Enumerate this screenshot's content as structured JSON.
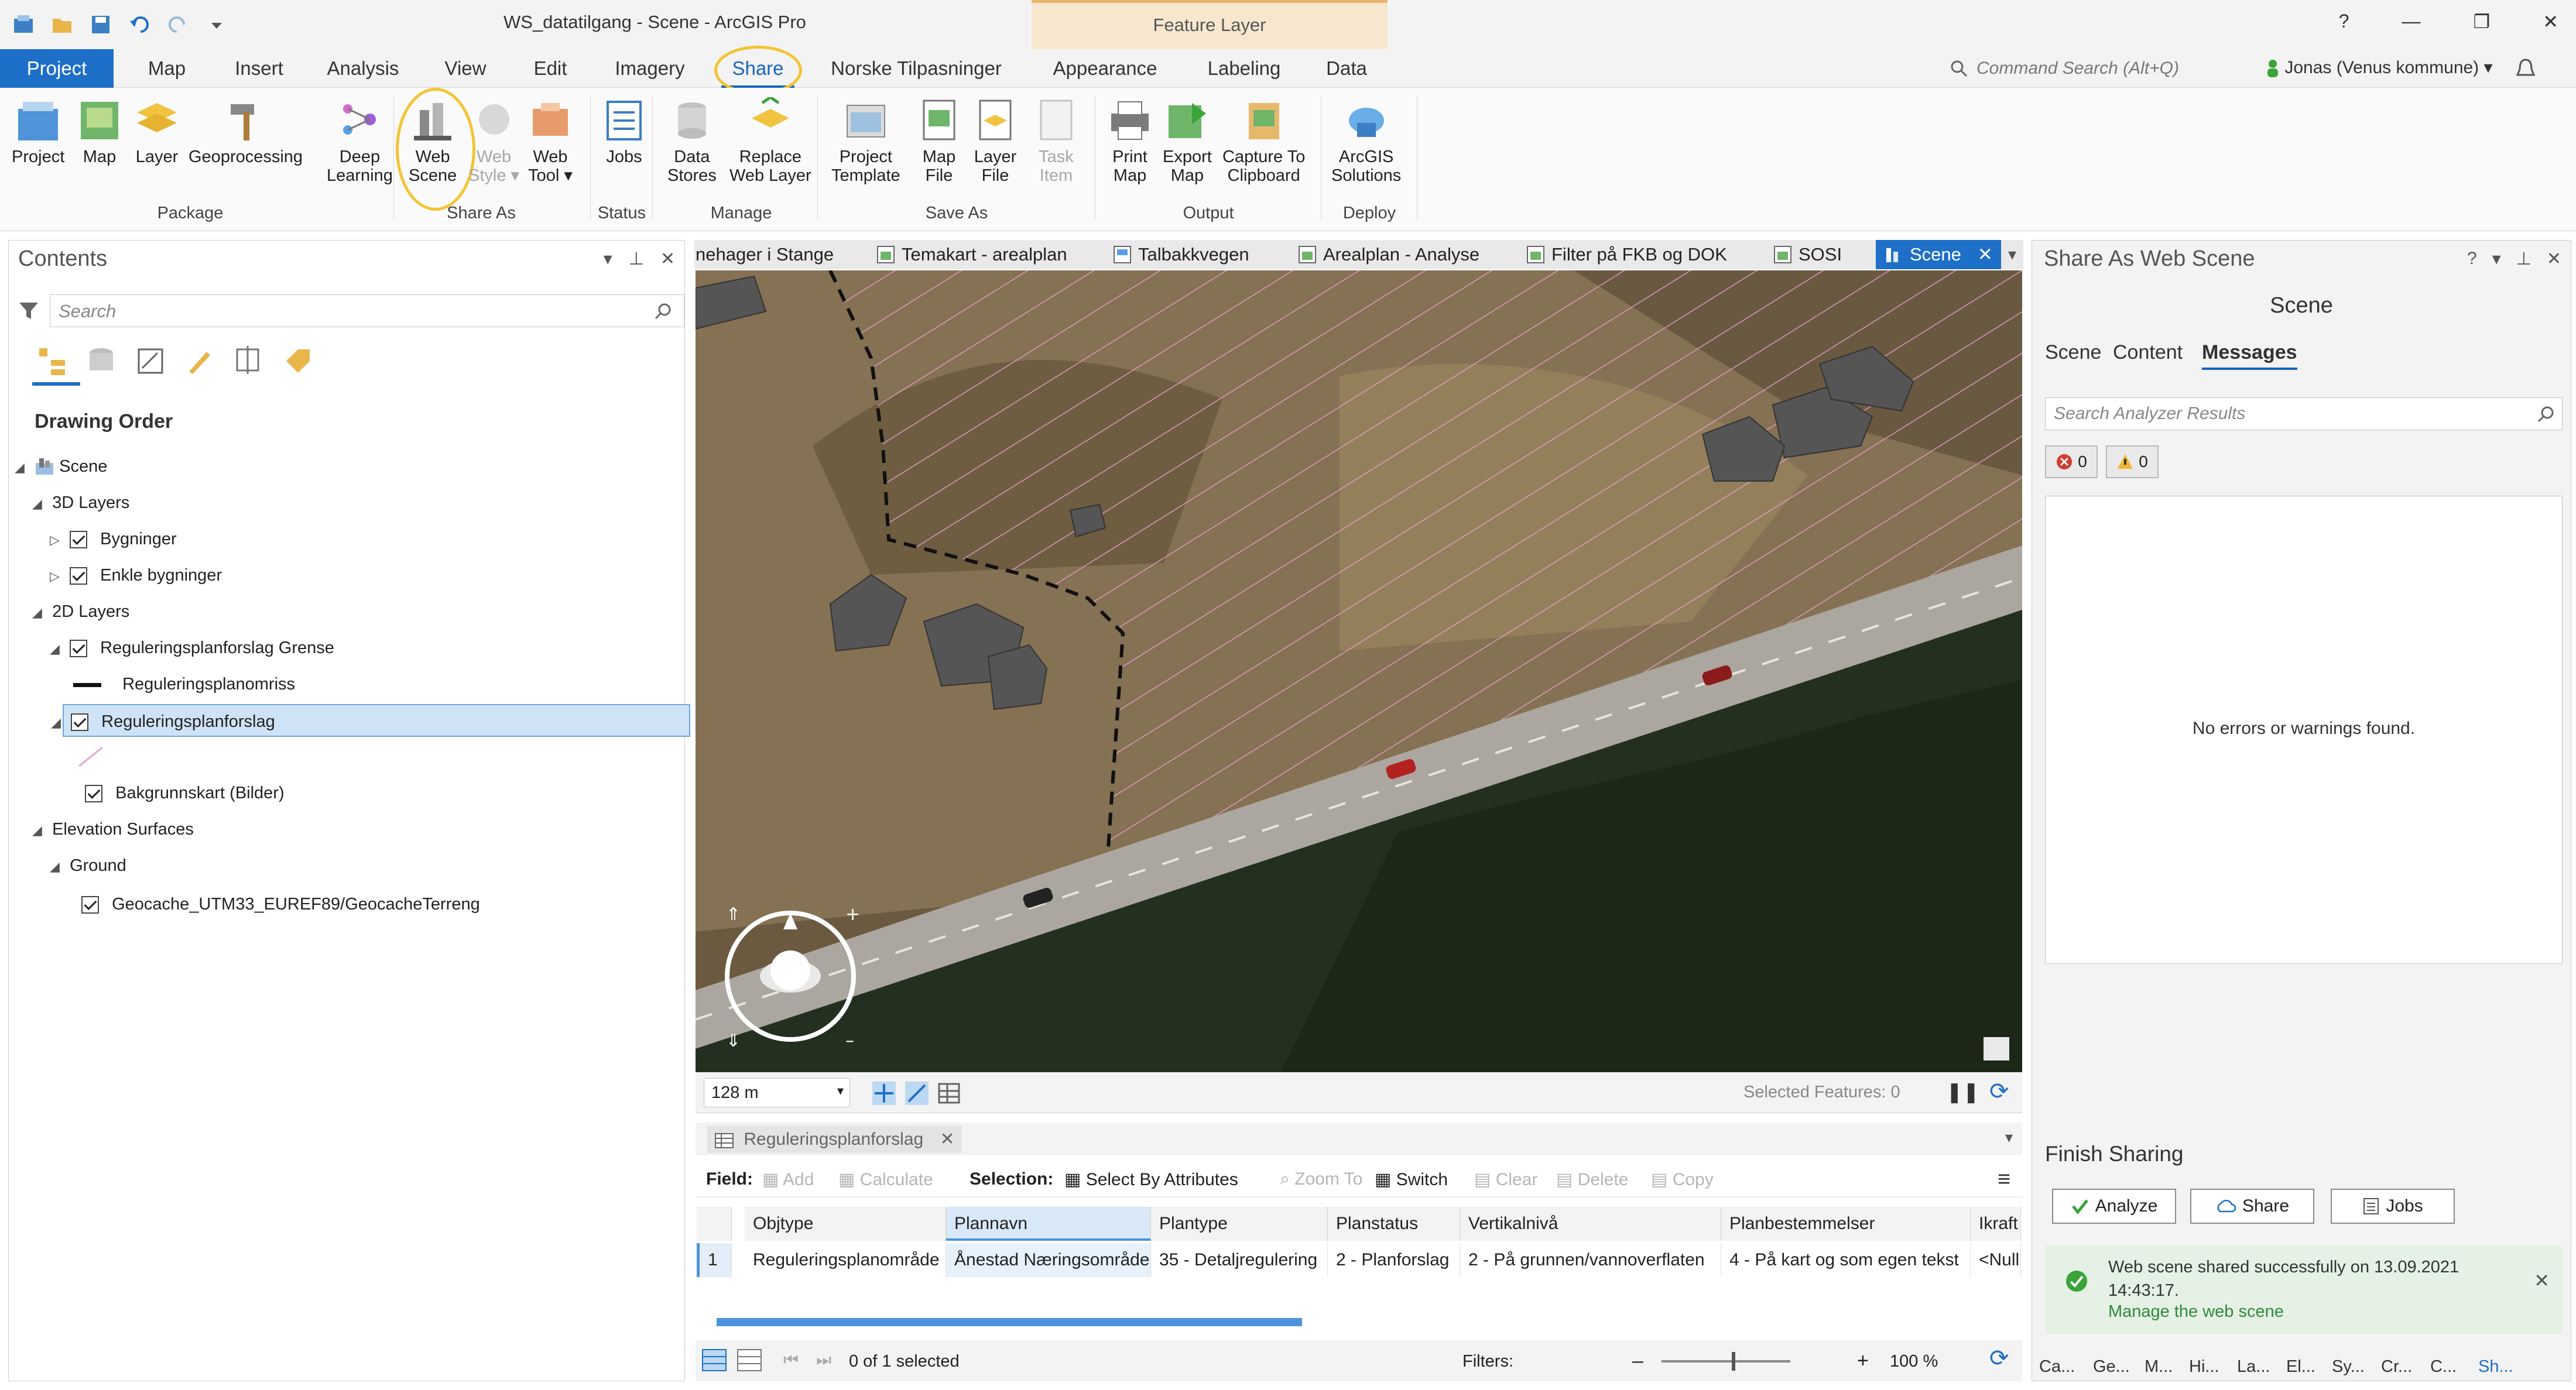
{
  "window": {
    "title": "WS_datatilgang - Scene - ArcGIS Pro",
    "context_tab_group": "Feature Layer",
    "help": "?",
    "minimize": "—",
    "maximize": "❐",
    "close": "✕"
  },
  "ribbon_tabs": [
    {
      "label": "Project"
    },
    {
      "label": "Map"
    },
    {
      "label": "Insert"
    },
    {
      "label": "Analysis"
    },
    {
      "label": "View"
    },
    {
      "label": "Edit"
    },
    {
      "label": "Imagery"
    },
    {
      "label": "Share"
    },
    {
      "label": "Norske Tilpasninger"
    },
    {
      "label": "Appearance"
    },
    {
      "label": "Labeling"
    },
    {
      "label": "Data"
    }
  ],
  "command_search": {
    "placeholder": "Command Search (Alt+Q)"
  },
  "user": {
    "name": "Jonas (Venus kommune) ▾"
  },
  "ribbon": {
    "buttons": [
      {
        "label": "Project"
      },
      {
        "label": "Map"
      },
      {
        "label": "Layer"
      },
      {
        "label": "Geoprocessing"
      },
      {
        "label": "Deep\nLearning"
      },
      {
        "label": "Web\nScene"
      },
      {
        "label": "Web\nStyle ▾"
      },
      {
        "label": "Web\nTool ▾"
      },
      {
        "label": "Jobs"
      },
      {
        "label": "Data\nStores"
      },
      {
        "label": "Replace\nWeb Layer"
      },
      {
        "label": "Project\nTemplate"
      },
      {
        "label": "Map\nFile"
      },
      {
        "label": "Layer\nFile"
      },
      {
        "label": "Task\nItem"
      },
      {
        "label": "Print\nMap"
      },
      {
        "label": "Export\nMap"
      },
      {
        "label": "Capture To\nClipboard"
      },
      {
        "label": "ArcGIS\nSolutions"
      }
    ],
    "groups": [
      {
        "label": "Package"
      },
      {
        "label": "Share As"
      },
      {
        "label": "Status"
      },
      {
        "label": "Manage"
      },
      {
        "label": "Save As"
      },
      {
        "label": "Output"
      },
      {
        "label": "Deploy"
      }
    ]
  },
  "contents": {
    "title": "Contents",
    "search_placeholder": "Search",
    "drawing_order": "Drawing Order",
    "tree": [
      {
        "label": "Scene"
      },
      {
        "label": "3D Layers"
      },
      {
        "label": "Bygninger"
      },
      {
        "label": "Enkle bygninger"
      },
      {
        "label": "2D Layers"
      },
      {
        "label": "Reguleringsplanforslag Grense"
      },
      {
        "label": "Reguleringsplanomriss"
      },
      {
        "label": "Reguleringsplanforslag"
      },
      {
        "label": "Bakgrunnskart (Bilder)"
      },
      {
        "label": "Elevation Surfaces"
      },
      {
        "label": "Ground"
      },
      {
        "label": "Geocache_UTM33_EUREF89/GeocacheTerreng"
      }
    ]
  },
  "view_tabs": [
    {
      "label": "nehager i Stange"
    },
    {
      "label": "Temakart - arealplan"
    },
    {
      "label": "Talbakkvegen"
    },
    {
      "label": "Arealplan - Analyse"
    },
    {
      "label": "Filter på FKB og DOK"
    },
    {
      "label": "SOSI"
    },
    {
      "label": "Scene"
    }
  ],
  "map_status": {
    "scale": "128 m",
    "selected_features": "Selected Features: 0"
  },
  "attribute_table": {
    "tab_label": "Reguleringsplanforslag",
    "toolbar": {
      "field": "Field:",
      "add": "Add",
      "calculate": "Calculate",
      "selection": "Selection:",
      "select_by_attributes": "Select By Attributes",
      "zoom_to": "Zoom To",
      "switch": "Switch",
      "clear": "Clear",
      "delete": "Delete",
      "copy": "Copy"
    },
    "columns": [
      "Objtype",
      "Plannavn",
      "Plantype",
      "Planstatus",
      "Vertikalnivå",
      "Planbestemmelser",
      "Ikraft"
    ],
    "rows": [
      {
        "num": "1",
        "cells": [
          "Reguleringsplanområde",
          "Ånestad Næringsområde",
          "35 - Detaljregulering",
          "2 - Planforslag",
          "2 - På grunnen/vannoverflaten",
          "4 - På kart og som egen tekst",
          "<Null>"
        ]
      }
    ],
    "footer": {
      "selected": "0 of 1 selected",
      "filters": "Filters:",
      "zoom": "100 %"
    }
  },
  "share_pane": {
    "title": "Share As Web Scene",
    "subtitle": "Scene",
    "tabs": [
      {
        "label": "Scene"
      },
      {
        "label": "Content"
      },
      {
        "label": "Messages"
      }
    ],
    "search_placeholder": "Search Analyzer Results",
    "errors_count": "0",
    "warnings_count": "0",
    "no_errors_text": "No errors or warnings found.",
    "finish_sharing": "Finish Sharing",
    "buttons": [
      {
        "label": "Analyze"
      },
      {
        "label": "Share"
      },
      {
        "label": "Jobs"
      }
    ],
    "success_message": "Web scene shared successfully on 13.09.2021 14:43:17.",
    "success_link": "Manage the web scene",
    "bottom_tabs": [
      "Ca...",
      "Ge...",
      "M...",
      "Hi...",
      "La...",
      "El...",
      "Sy...",
      "Cr...",
      "C...",
      "Sh..."
    ]
  },
  "colors": {
    "accent": "#1e6fc8",
    "highlight_ring": "#f4c432",
    "success": "#2f8a3a",
    "plan_hatch": "#e7a2d6"
  }
}
